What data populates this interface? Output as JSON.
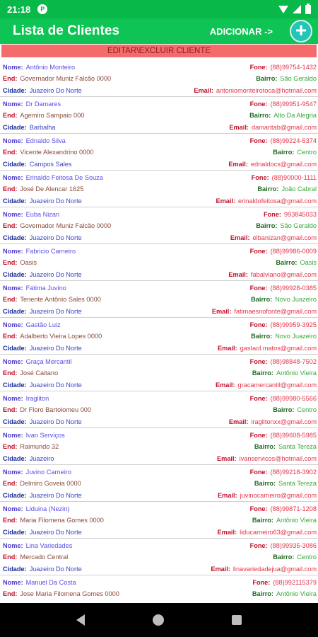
{
  "statusbar": {
    "time": "21:18",
    "app_icon": "P"
  },
  "appbar": {
    "title": "Lista de Clientes",
    "add_label": "ADICIONAR ->",
    "add_symbol": "+"
  },
  "banner": {
    "label": "EDITAR\\EXCLUIR CLIENTE"
  },
  "labels": {
    "nome": "Nome:",
    "end": "End:",
    "cidade": "Cidade:",
    "fone": "Fone:",
    "bairro": "Bairro:",
    "email": "Email:"
  },
  "clients": [
    {
      "nome": "Antônio Monteiro",
      "fone": "(88)99754-1432",
      "end": "Governador Muniz Falcão 0000",
      "bairro": "São Geraldo",
      "cidade": "Juazeiro Do Norte",
      "email": "antoniomonteirotoca@hotmail.com"
    },
    {
      "nome": "Dr Damares",
      "fone": "(88)99951-9547",
      "end": "Agemiro Sampaio 000",
      "bairro": "Alto Da Alegria",
      "cidade": "Barbalha",
      "email": "damaritab@gmail.com"
    },
    {
      "nome": "Ednaldo Silva",
      "fone": "(88)99224-5374",
      "end": "Vicente Alexandrino 0000",
      "bairro": "Centro",
      "cidade": "Campos Sales",
      "email": "ednaldocs@gmail.com"
    },
    {
      "nome": "Erinaldo Feitosa De Souza",
      "fone": "(88)90000-1111",
      "end": "José De Alencar 1625",
      "bairro": "João Cabral",
      "cidade": "Juazeiro Do Norte",
      "email": "erinaldofeitosa@gmail.com"
    },
    {
      "nome": "Euba Nizan",
      "fone": "993845033",
      "end": "Governador Muniz Falcão 0000",
      "bairro": "São Geraldo",
      "cidade": "Juazeiro Do Norte",
      "email": "elbanizan@gmail.com"
    },
    {
      "nome": "Fabricio Carneiro",
      "fone": "(88)99986-0009",
      "end": "Oasis",
      "bairro": "Oasis",
      "cidade": "Juazeiro Do Norte",
      "email": "fabalviano@gmail.com"
    },
    {
      "nome": "Fátima Juvino",
      "fone": "(88)99928-0385",
      "end": "Tenente Antônio Sales 0000",
      "bairro": "Novo Juazeiro",
      "cidade": "Juazeiro Do Norte",
      "email": "fatimaesnofonte@gmail.com"
    },
    {
      "nome": "Gastão Luiz",
      "fone": "(88)99959-3925",
      "end": "Adalberto Vieira Lopes 0000",
      "bairro": "Novo Juazeiro",
      "cidade": "Juazeiro Do Norte",
      "email": "gastaol.matos@gmail.com"
    },
    {
      "nome": "Graça Mercantil",
      "fone": "(88)98848-7502",
      "end": "José Caitano",
      "bairro": "Antônio Vieira",
      "cidade": "Juazeiro Do Norte",
      "email": "gracamercantil@gmail.com"
    },
    {
      "nome": "Iragliton",
      "fone": "(88)99980-5566",
      "end": "Dr Floro Bartolomeu 000",
      "bairro": "Centro",
      "cidade": "Juazeiro Do Norte",
      "email": "iraglitonxx@gmail.com"
    },
    {
      "nome": "Ivan Serviços",
      "fone": "(88)99608-5985",
      "end": "Raimundo 32",
      "bairro": "Santa Tereza",
      "cidade": "Juazeiro",
      "email": "ivanservicos@hotmail.com"
    },
    {
      "nome": "Juvino Carneiro",
      "fone": "(88)99218-3902",
      "end": "Delmiro Goveia 0000",
      "bairro": "Santa Tereza",
      "cidade": "Juazeiro Do Norte",
      "email": "juvinocarneiro@gmail.com"
    },
    {
      "nome": "Liduina (Nezin)",
      "fone": "(88)99871-1208",
      "end": "Maria Filomena Gomes 0000",
      "bairro": "Antônio Vieira",
      "cidade": "Juazeiro Do Norte",
      "email": "liducarneiro63@gmail.com"
    },
    {
      "nome": "Lina Variedades",
      "fone": "(88)99935-3086",
      "end": "Mercado Central",
      "bairro": "Centro",
      "cidade": "Juazeiro Do Norte",
      "email": "linavariedadejua@gmail.com"
    },
    {
      "nome": "Manuel Da Costa",
      "fone": "(88)992115379",
      "end": "Jose Maria Filomena Gomes 0000",
      "bairro": "Antônio Vieira",
      "cidade": "",
      "email": ""
    }
  ],
  "colors": {
    "statusbar": "#08b848",
    "appbar": "#0ec455",
    "banner": "#f36b6b",
    "add_button": "#24c4b8"
  },
  "icons": {
    "status": [
      "wifi-icon",
      "signal-icon",
      "battery-icon"
    ],
    "nav": [
      "back-icon",
      "home-icon",
      "recents-icon"
    ]
  }
}
